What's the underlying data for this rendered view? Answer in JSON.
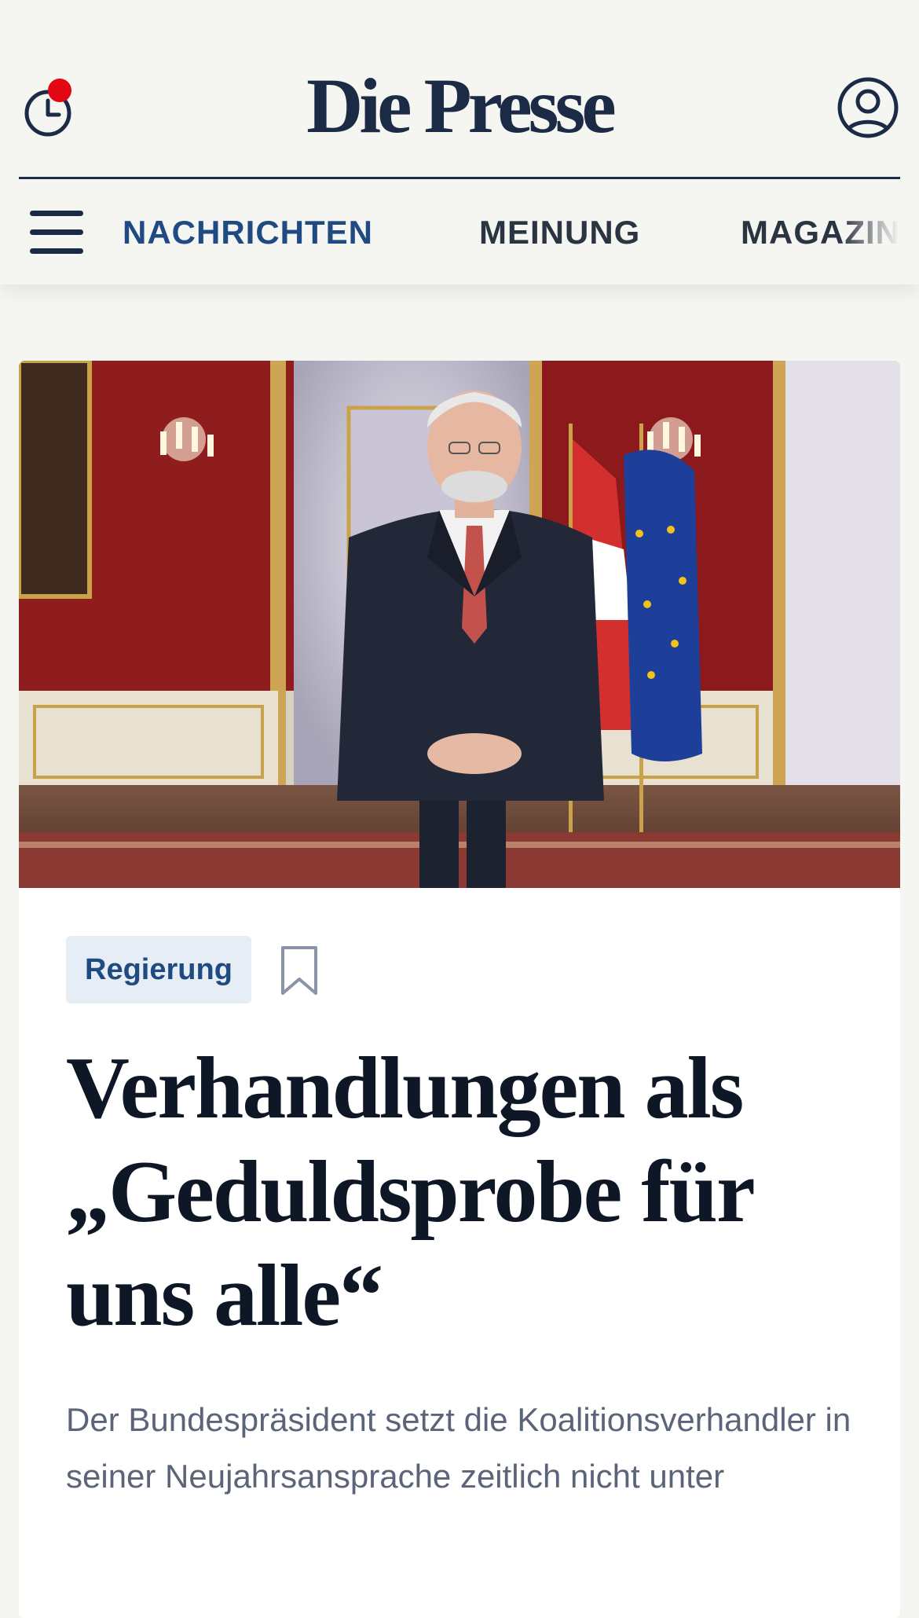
{
  "header": {
    "logo": "Die Presse",
    "clock_icon": "clock-icon",
    "notification_color": "#e30613",
    "account_icon": "user-account-icon",
    "menu_icon": "hamburger-menu-icon"
  },
  "nav": {
    "items": [
      {
        "label": "NACHRICHTEN",
        "active": true
      },
      {
        "label": "MEINUNG",
        "active": false
      },
      {
        "label": "MAGAZIN",
        "active": false
      }
    ]
  },
  "article": {
    "image_alt": "Bundespräsident vor rot tapezierter Wand mit Kronleuchtern und Flaggen",
    "tag": "Regierung",
    "bookmark_icon": "bookmark-icon",
    "headline": "Verhandlungen als „Geduldsprobe für uns alle“",
    "lead": "Der Bundespräsident setzt die Koalitionsverhandler in seiner Neujahrsansprache zeitlich nicht unter"
  },
  "colors": {
    "brand_navy": "#1c2b45",
    "nav_active": "#1f4a82",
    "tag_bg": "#e7edf4",
    "background": "#f5f5f1"
  }
}
